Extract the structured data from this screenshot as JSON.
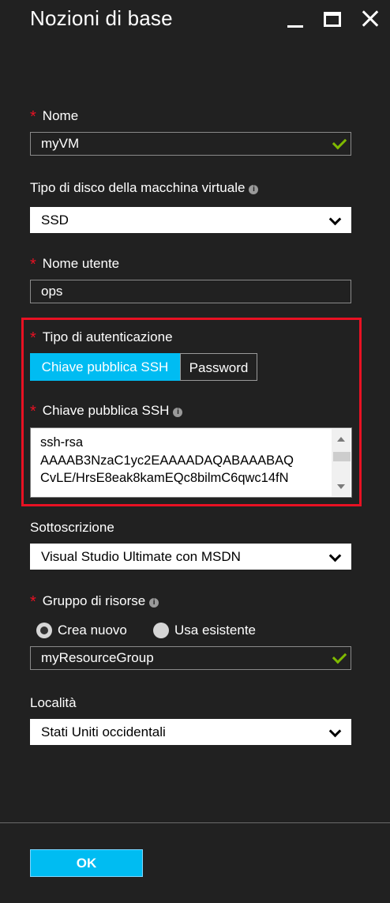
{
  "window": {
    "title": "Nozioni di base",
    "minimize_icon": "minimize-icon",
    "maximize_icon": "maximize-icon",
    "close_icon": "close-icon"
  },
  "form": {
    "name": {
      "label": "Nome",
      "required": "*",
      "value": "myVM",
      "valid": true
    },
    "disk_type": {
      "label": "Tipo di disco della macchina virtuale",
      "value": "SSD"
    },
    "username": {
      "label": "Nome utente",
      "required": "*",
      "value": "ops"
    },
    "auth_type": {
      "label": "Tipo di autenticazione",
      "required": "*",
      "options": [
        "Chiave pubblica SSH",
        "Password"
      ],
      "selected": "Chiave pubblica SSH"
    },
    "ssh_key": {
      "label": "Chiave pubblica SSH",
      "required": "*",
      "lines": [
        "ssh-rsa",
        "AAAAB3NzaC1yc2EAAAADAQABAAABAQ",
        "CvLE/HrsE8eak8kamEQc8bilmC6qwc14fN"
      ]
    },
    "subscription": {
      "label": "Sottoscrizione",
      "value": "Visual Studio Ultimate con MSDN"
    },
    "resource_group": {
      "label": "Gruppo di risorse",
      "required": "*",
      "radio_new": "Crea nuovo",
      "radio_existing": "Usa esistente",
      "selected": "Crea nuovo",
      "value": "myResourceGroup",
      "valid": true
    },
    "location": {
      "label": "Località",
      "value": "Stati Uniti occidentali"
    }
  },
  "footer": {
    "ok_label": "OK"
  },
  "colors": {
    "background": "#212121",
    "accent": "#00bcf2",
    "required": "#e81123",
    "valid": "#7fba00",
    "highlight_border": "#e81123"
  }
}
